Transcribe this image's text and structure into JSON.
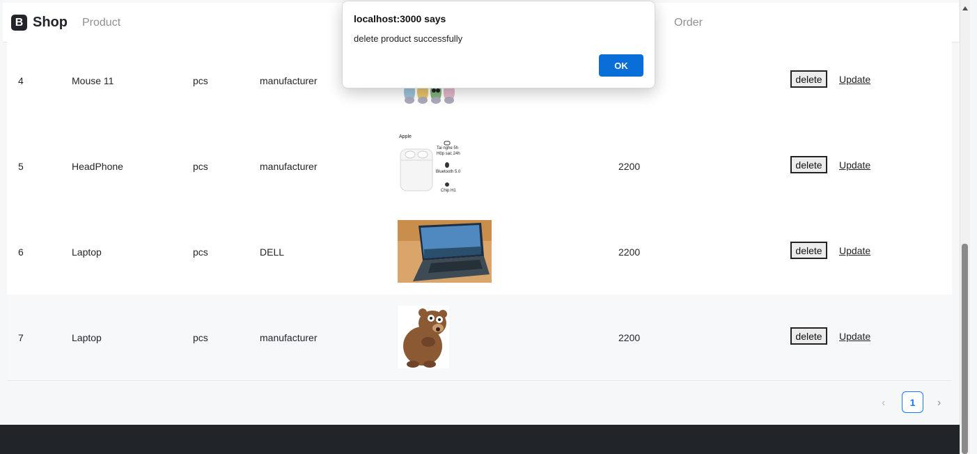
{
  "navbar": {
    "brand_letter": "B",
    "brand_text": "Shop",
    "links": [
      "Product",
      "Order"
    ]
  },
  "dialog": {
    "title": "localhost:3000 says",
    "message": "delete product successfully",
    "ok_label": "OK"
  },
  "rows": [
    {
      "id": "4",
      "name": "Mouse 11",
      "unit": "pcs",
      "brand": "manufacturer",
      "price": "",
      "image": "mouse-image",
      "delete_label": "delete",
      "update_label": "Update"
    },
    {
      "id": "5",
      "name": "HeadPhone",
      "unit": "pcs",
      "brand": "manufacturer",
      "price": "2200",
      "image": "airpods-image",
      "delete_label": "delete",
      "update_label": "Update"
    },
    {
      "id": "6",
      "name": "Laptop",
      "unit": "pcs",
      "brand": "DELL",
      "price": "2200",
      "image": "laptop-image",
      "delete_label": "delete",
      "update_label": "Update"
    },
    {
      "id": "7",
      "name": "Laptop",
      "unit": "pcs",
      "brand": "manufacturer",
      "price": "2200",
      "image": "bear-image",
      "delete_label": "delete",
      "update_label": "Update"
    }
  ],
  "airpods_image_text": {
    "brand": "Apple",
    "line1": "Tai nghe 5h",
    "line2": "Hộp sạc 24h",
    "line3": "Bluetooth 5.0",
    "line4": "Chip H1"
  },
  "pagination": {
    "prev": "‹",
    "current_page": "1",
    "next": "›"
  },
  "colors": {
    "accent": "#1677ff",
    "dialog_button": "#0a6ed8",
    "footer": "#212529"
  }
}
